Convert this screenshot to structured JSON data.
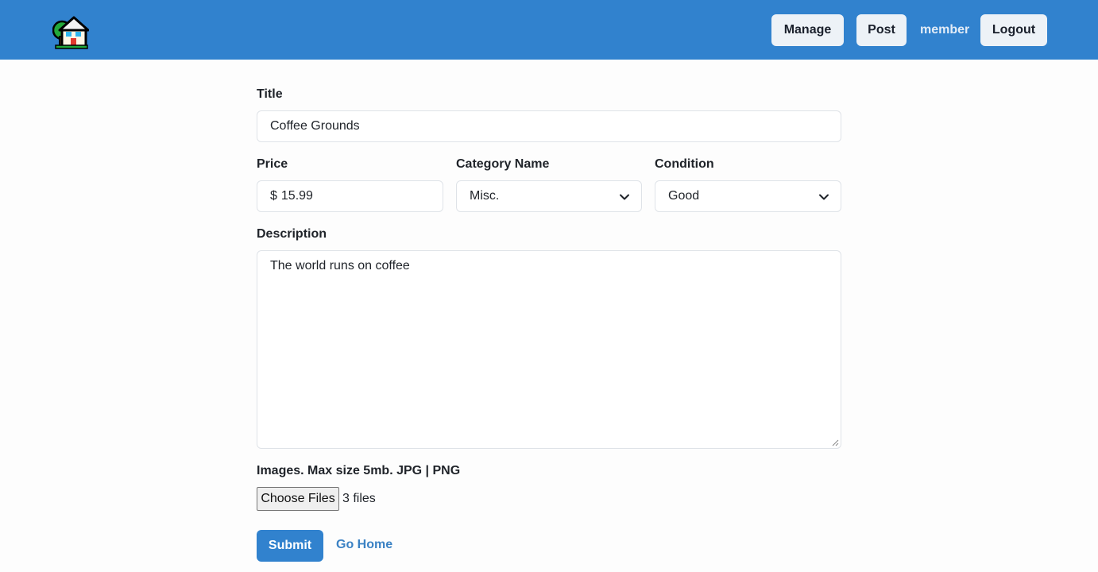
{
  "header": {
    "logo_icon": "house-with-tree-icon",
    "manage_label": "Manage",
    "post_label": "Post",
    "user_label": "member",
    "logout_label": "Logout"
  },
  "form": {
    "title_label": "Title",
    "title_value": "Coffee Grounds",
    "price_label": "Price",
    "price_prefix": "$",
    "price_value": "15.99",
    "category_label": "Category Name",
    "category_value": "Misc.",
    "condition_label": "Condition",
    "condition_value": "Good",
    "description_label": "Description",
    "description_value": "The world runs on coffee",
    "images_label": "Images. Max size 5mb. JPG | PNG",
    "choose_files_label": "Choose Files",
    "files_status": "3 files",
    "submit_label": "Submit",
    "home_link_label": "Go Home"
  },
  "colors": {
    "navbar": "#3182ce",
    "button_bg": "#edf2f7",
    "primary": "#3182ce",
    "link": "#3b82c4"
  }
}
